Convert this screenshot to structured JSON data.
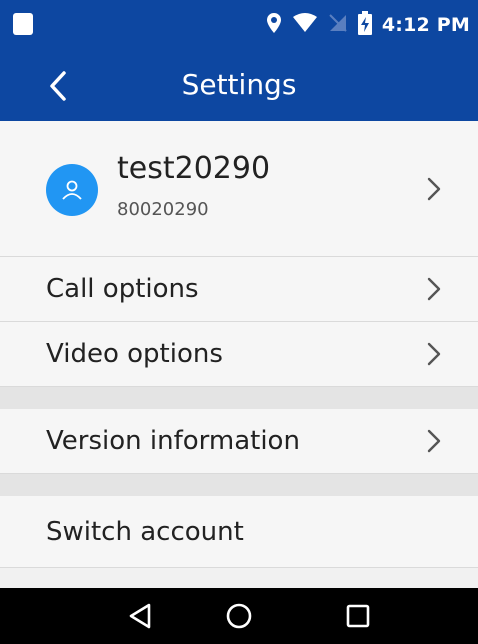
{
  "status_bar": {
    "time": "4:12 PM",
    "icons": [
      "notification-square-icon",
      "location-pin-icon",
      "wifi-icon",
      "no-sim-icon",
      "battery-charging-icon"
    ]
  },
  "toolbar": {
    "title": "Settings",
    "back_icon": "back-arrow-icon"
  },
  "profile": {
    "name": "test20290",
    "number": "80020290",
    "avatar_icon": "user-avatar-icon"
  },
  "settings": {
    "items": [
      {
        "label": "Call options"
      },
      {
        "label": "Video options"
      },
      {
        "label": "Version information"
      },
      {
        "label": "Switch account"
      }
    ]
  },
  "navigation": {
    "back": "nav-back-icon",
    "home": "nav-home-icon",
    "recents": "nav-recents-icon"
  },
  "colors": {
    "header": "#0d47a1",
    "avatar": "#2196f3",
    "background": "#f6f6f6",
    "nav_bar": "#000000"
  }
}
